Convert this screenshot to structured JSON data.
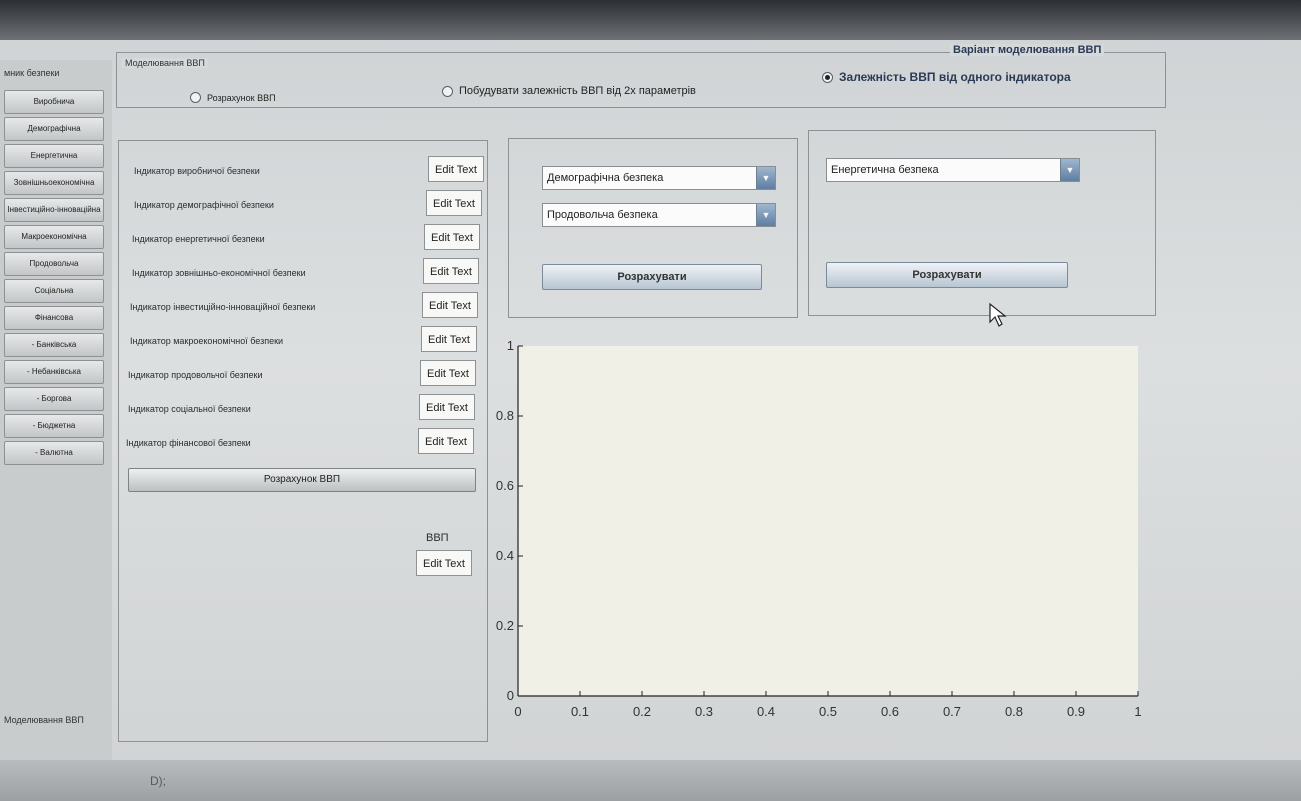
{
  "sidebar": {
    "header": "мник безпеки",
    "items": [
      "Виробнича",
      "Демографічна",
      "Енергетична",
      "Зовнішньоекономічна",
      "Інвестиційно-інноваційна",
      "Макроекономічна",
      "Продовольча",
      "Соціальна",
      "Фінансова",
      "- Банківська",
      "- Небанківська",
      "- Боргова",
      "- Бюджетна",
      "- Валютна"
    ],
    "footer": "Моделювання ВВП"
  },
  "modeling_group": {
    "outer_title": "Варіант моделювання ВВП",
    "inner_title": "Моделювання ВВП",
    "options": [
      {
        "label": "Розрахунок ВВП",
        "selected": false
      },
      {
        "label": "Побудувати залежність ВВП від 2х параметрів",
        "selected": false
      },
      {
        "label": "Залежність ВВП від одного індикатора",
        "selected": true
      }
    ]
  },
  "indicators": {
    "labels": [
      "Індикатор виробничої безпеки",
      "Індикатор демографічної безпеки",
      "Індикатор енергетичної безпеки",
      "Індикатор зовнішньо-економічної безпеки",
      "Індикатор інвестиційно-інноваційної безпеки",
      "Індикатор макроекономічної безпеки",
      "Індикатор продовольчої безпеки",
      "Індикатор соціальної безпеки",
      "Індикатор фінансової безпеки"
    ],
    "edit_text": "Edit Text",
    "calc_button": "Розрахунок ВВП",
    "gdp_label": "ВВП"
  },
  "two_param_panel": {
    "select_1": "Демографічна безпека",
    "select_2": "Продовольча безпека",
    "button": "Розрахувати"
  },
  "one_param_panel": {
    "select": "Енергетична безпека",
    "button": "Розрахувати"
  },
  "chart_data": {
    "type": "line",
    "series": [],
    "xlim": [
      0,
      1
    ],
    "ylim": [
      0,
      1
    ],
    "xticks": [
      0,
      0.1,
      0.2,
      0.3,
      0.4,
      0.5,
      0.6,
      0.7,
      0.8,
      0.9,
      1
    ],
    "xtick_labels": [
      "0",
      "0.1",
      "0.2",
      "0.3",
      "0.4",
      "0.5",
      "0.6",
      "0.7",
      "0.8",
      "0.9",
      "1"
    ],
    "yticks": [
      0,
      0.2,
      0.4,
      0.6,
      0.8,
      1
    ],
    "ytick_labels": [
      "0",
      "0.2",
      "0.4",
      "0.6",
      "0.8",
      "1"
    ],
    "grid": false,
    "plot_background": "#f0f0e6"
  },
  "colors": {
    "window_bg": "#d6d9da",
    "dropdown_arrow": "#5f7ea2",
    "selected_radio": "#1f2328"
  },
  "icons": [
    "radio-button",
    "dropdown-arrow-icon",
    "mouse-pointer-icon"
  ],
  "status_stub": "D);"
}
